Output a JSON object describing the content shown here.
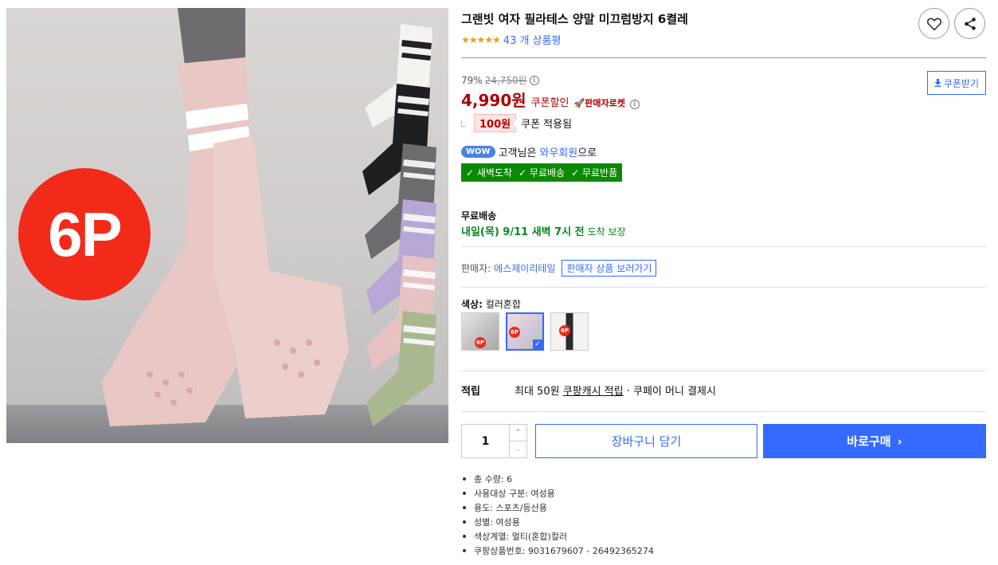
{
  "product": {
    "title": "그랜빗 여자 필라테스 양말 미끄럼방지 6켤레",
    "stars": "★★★★★",
    "review_count": "43 개 상품평",
    "image_badge": "6P"
  },
  "actions": {
    "wishlist_icon": "heart-icon",
    "share_icon": "share-icon"
  },
  "price": {
    "discount_rate": "79%",
    "original_price": "24,750원",
    "sale_price": "4,990원",
    "coupon_discount_label": "쿠폰할인",
    "seller_rocket": "🚀판매자로켓",
    "coupon_button": "쿠폰받기",
    "coupon_amount": "100원",
    "coupon_applied": "쿠폰 적용됨"
  },
  "wow": {
    "badge": "WOW",
    "text_prefix": "고객님은",
    "member_link": "와우회원",
    "text_suffix": "으로",
    "benefits": [
      "새벽도착",
      "무료배송",
      "무료반품"
    ]
  },
  "shipping": {
    "title": "무료배송",
    "date": "내일(목) 9/11 새벽 7시 전",
    "guarantee": "도착 보장"
  },
  "seller": {
    "label": "판매자:",
    "name": "에스제이리테일",
    "button": "판매자 상품 보러가기"
  },
  "color": {
    "label": "색상:",
    "value": "컬러혼합",
    "swatch_badge": "6P",
    "swatch_count": 3,
    "selected_index": 1
  },
  "points": {
    "label": "적립",
    "max": "최대 50원",
    "cash_link": "쿠팡캐시 적립",
    "pay_note": "· 쿠페이 머니 결제시"
  },
  "purchase": {
    "quantity": "1",
    "cart_button": "장바구니 담기",
    "buy_button": "바로구매"
  },
  "specs": [
    "총 수량: 6",
    "사용대상 구분: 여성용",
    "용도: 스포츠/등산용",
    "성별: 여성용",
    "색상계열: 멀티(혼합)컬러",
    "쿠팡상품번호: 9031679607 - 26492365274"
  ],
  "colors": {
    "accent": "#346aff",
    "price_red": "#ae0000",
    "delivery_green": "#00891a",
    "benefit_green": "#0b8a00",
    "badge_red": "#f22a1a"
  }
}
